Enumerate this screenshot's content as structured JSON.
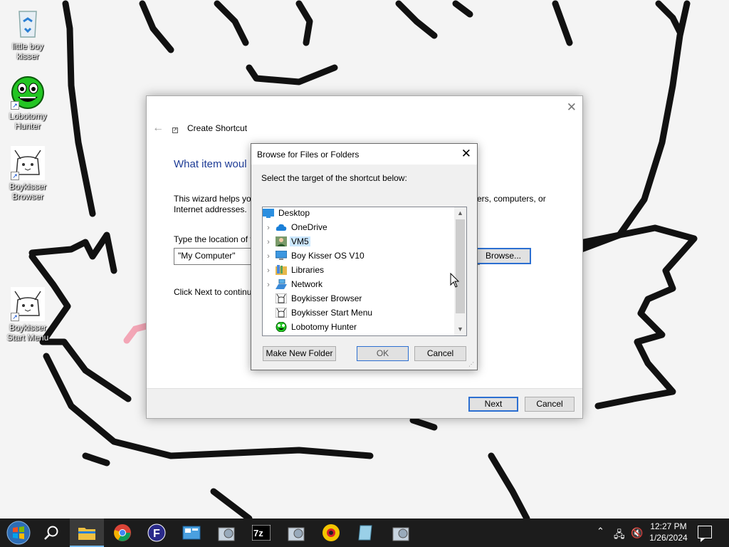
{
  "desktop": {
    "icons": [
      {
        "label": "little boy kisser"
      },
      {
        "label": "Lobotomy Hunter"
      },
      {
        "label": "Boykisser Browser"
      },
      {
        "label": "Boykisser Start Menu"
      }
    ]
  },
  "wizard": {
    "title": "Create Shortcut",
    "heading": "What item woul",
    "desc_left": "This wizard helps you",
    "desc_left2": "Internet addresses.",
    "desc_right": "ers, computers, or",
    "location_label": "Type the location of t",
    "location_value": "\"My Computer\"",
    "browse_label": "Browse...",
    "next_hint": "Click Next to continu",
    "next_label": "Next",
    "cancel_label": "Cancel"
  },
  "browse_dialog": {
    "title": "Browse for Files or Folders",
    "prompt": "Select the target of the shortcut below:",
    "tree": [
      {
        "label": "Desktop",
        "icon": "desktop-icon"
      },
      {
        "label": "OneDrive",
        "icon": "cloud-icon",
        "expandable": true
      },
      {
        "label": "VM5",
        "icon": "user-icon",
        "expandable": true,
        "selected": true
      },
      {
        "label": "Boy Kisser OS V10",
        "icon": "computer-icon",
        "expandable": true
      },
      {
        "label": "Libraries",
        "icon": "library-icon",
        "expandable": true
      },
      {
        "label": "Network",
        "icon": "network-icon",
        "expandable": true
      },
      {
        "label": "Boykisser Browser",
        "icon": "app-icon"
      },
      {
        "label": "Boykisser Start Menu",
        "icon": "app-icon"
      },
      {
        "label": "Lobotomy Hunter",
        "icon": "green-face-icon"
      }
    ],
    "make_folder_label": "Make New Folder",
    "ok_label": "OK",
    "cancel_label": "Cancel"
  },
  "taskbar": {
    "apps": [
      "start-button",
      "search-icon",
      "file-explorer-icon",
      "chrome-icon",
      "f-app-icon",
      "control-panel-icon",
      "app-icon",
      "7zip-icon",
      "app-icon",
      "yellow-browser-icon",
      "notepad-icon",
      "app-icon"
    ],
    "time": "12:27 PM",
    "date": "1/26/2024"
  },
  "colors": {
    "accent": "#2c6fd1",
    "heading_blue": "#1e3c96",
    "taskbar": "#1c1c1c",
    "selection": "#cce8ff"
  }
}
